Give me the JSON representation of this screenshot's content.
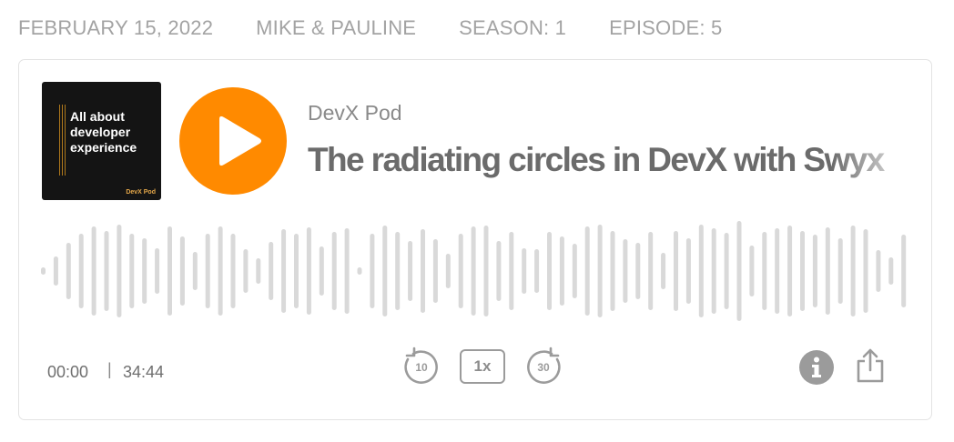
{
  "meta": {
    "date": "FEBRUARY 15, 2022",
    "hosts": "MIKE & PAULINE",
    "season": "SEASON: 1",
    "episode": "EPISODE: 5"
  },
  "cover": {
    "text": "All about developer experience",
    "brand": "DevX Pod"
  },
  "player": {
    "podcast_name": "DevX Pod",
    "episode_title": "The radiating circles in DevX with Swyx",
    "current_time": "00:00",
    "separator": "|",
    "total_time": "34:44",
    "rewind_seconds": "10",
    "speed_label": "1x",
    "forward_seconds": "30",
    "accent_color": "#ff8a00",
    "waveform_color": "#d9d9d9"
  },
  "icons": {
    "play": "play-icon",
    "rewind": "rewind-10-icon",
    "forward": "forward-30-icon",
    "info": "info-icon",
    "share": "share-icon"
  }
}
